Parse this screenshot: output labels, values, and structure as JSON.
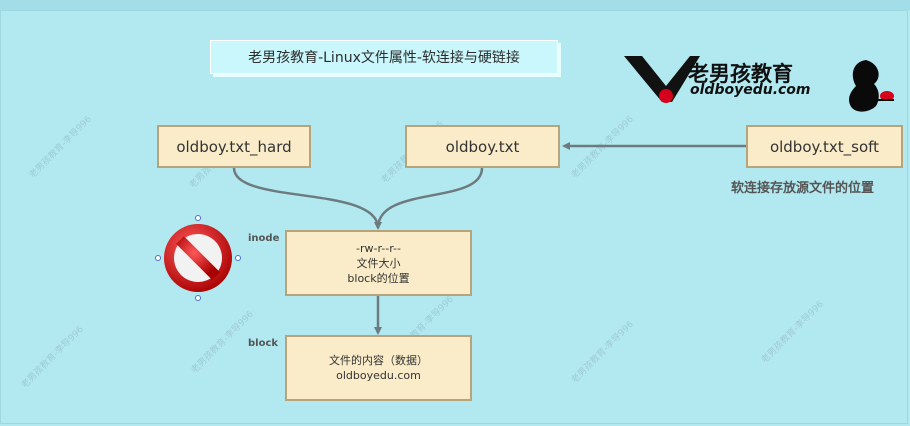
{
  "title": "老男孩教育-Linux文件属性-软连接与硬链接",
  "nodes": {
    "hard": "oldboy.txt_hard",
    "file": "oldboy.txt",
    "soft": "oldboy.txt_soft",
    "inode": {
      "line1": "-rw-r--r--",
      "line2": "文件大小",
      "line3": "block的位置"
    },
    "block": {
      "line1": "文件的内容（数据）",
      "line2": "oldboyedu.com"
    }
  },
  "labels": {
    "inode": "inode",
    "block": "block",
    "soft_note": "软连接存放源文件的位置"
  },
  "logo": {
    "cn": "老男孩教育",
    "en": "oldboyedu.com"
  },
  "watermark": "老男孩教育-李导996",
  "colors": {
    "background": "#b2e9f1",
    "node_fill": "#faecc9",
    "node_border": "#b8a47a",
    "connector": "#6e7b7e",
    "logo_red": "#d6001c"
  },
  "icons": {
    "forbidden": "prohibited-sign-icon",
    "silhouette": "woman-silhouette-icon"
  }
}
